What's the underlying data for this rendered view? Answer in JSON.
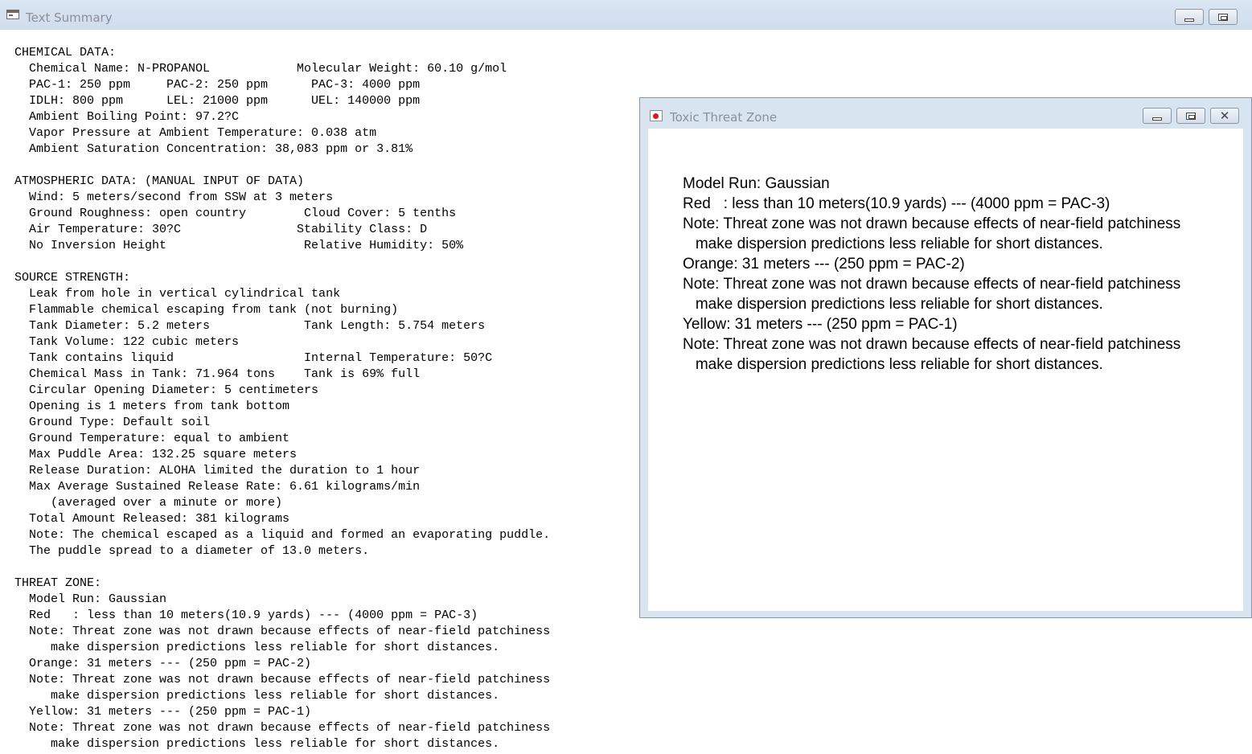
{
  "main_window": {
    "title": "Text Summary",
    "lines": [
      "CHEMICAL DATA:",
      "  Chemical Name: N-PROPANOL            Molecular Weight: 60.10 g/mol",
      "  PAC-1: 250 ppm     PAC-2: 250 ppm      PAC-3: 4000 ppm",
      "  IDLH: 800 ppm      LEL: 21000 ppm      UEL: 140000 ppm",
      "  Ambient Boiling Point: 97.2?C",
      "  Vapor Pressure at Ambient Temperature: 0.038 atm",
      "  Ambient Saturation Concentration: 38,083 ppm or 3.81%",
      "",
      "ATMOSPHERIC DATA: (MANUAL INPUT OF DATA)",
      "  Wind: 5 meters/second from SSW at 3 meters",
      "  Ground Roughness: open country        Cloud Cover: 5 tenths",
      "  Air Temperature: 30?C                Stability Class: D",
      "  No Inversion Height                   Relative Humidity: 50%",
      "",
      "SOURCE STRENGTH:",
      "  Leak from hole in vertical cylindrical tank",
      "  Flammable chemical escaping from tank (not burning)",
      "  Tank Diameter: 5.2 meters             Tank Length: 5.754 meters",
      "  Tank Volume: 122 cubic meters",
      "  Tank contains liquid                  Internal Temperature: 50?C",
      "  Chemical Mass in Tank: 71.964 tons    Tank is 69% full",
      "  Circular Opening Diameter: 5 centimeters",
      "  Opening is 1 meters from tank bottom",
      "  Ground Type: Default soil",
      "  Ground Temperature: equal to ambient",
      "  Max Puddle Area: 132.25 square meters",
      "  Release Duration: ALOHA limited the duration to 1 hour",
      "  Max Average Sustained Release Rate: 6.61 kilograms/min",
      "     (averaged over a minute or more)",
      "  Total Amount Released: 381 kilograms",
      "  Note: The chemical escaped as a liquid and formed an evaporating puddle.",
      "  The puddle spread to a diameter of 13.0 meters.",
      "",
      "THREAT ZONE:",
      "  Model Run: Gaussian",
      "  Red   : less than 10 meters(10.9 yards) --- (4000 ppm = PAC-3)",
      "  Note: Threat zone was not drawn because effects of near-field patchiness",
      "     make dispersion predictions less reliable for short distances.",
      "  Orange: 31 meters --- (250 ppm = PAC-2)",
      "  Note: Threat zone was not drawn because effects of near-field patchiness",
      "     make dispersion predictions less reliable for short distances.",
      "  Yellow: 31 meters --- (250 ppm = PAC-1)",
      "  Note: Threat zone was not drawn because effects of near-field patchiness",
      "     make dispersion predictions less reliable for short distances."
    ]
  },
  "toxic_window": {
    "title": "Toxic Threat Zone",
    "close_glyph": "✕",
    "lines": [
      "Model Run: Gaussian",
      "Red   : less than 10 meters(10.9 yards) --- (4000 ppm = PAC-3)",
      "Note: Threat zone was not drawn because effects of near-field patchiness",
      "   make dispersion predictions less reliable for short distances.",
      "Orange: 31 meters --- (250 ppm = PAC-2)",
      "Note: Threat zone was not drawn because effects of near-field patchiness",
      "   make dispersion predictions less reliable for short distances.",
      "Yellow: 31 meters --- (250 ppm = PAC-1)",
      "Note: Threat zone was not drawn because effects of near-field patchiness",
      "   make dispersion predictions less reliable for short distances."
    ]
  },
  "colors": {
    "titlebar": "#d3dfee",
    "title_text": "#8a8f99",
    "window_border": "#8a98ab"
  }
}
